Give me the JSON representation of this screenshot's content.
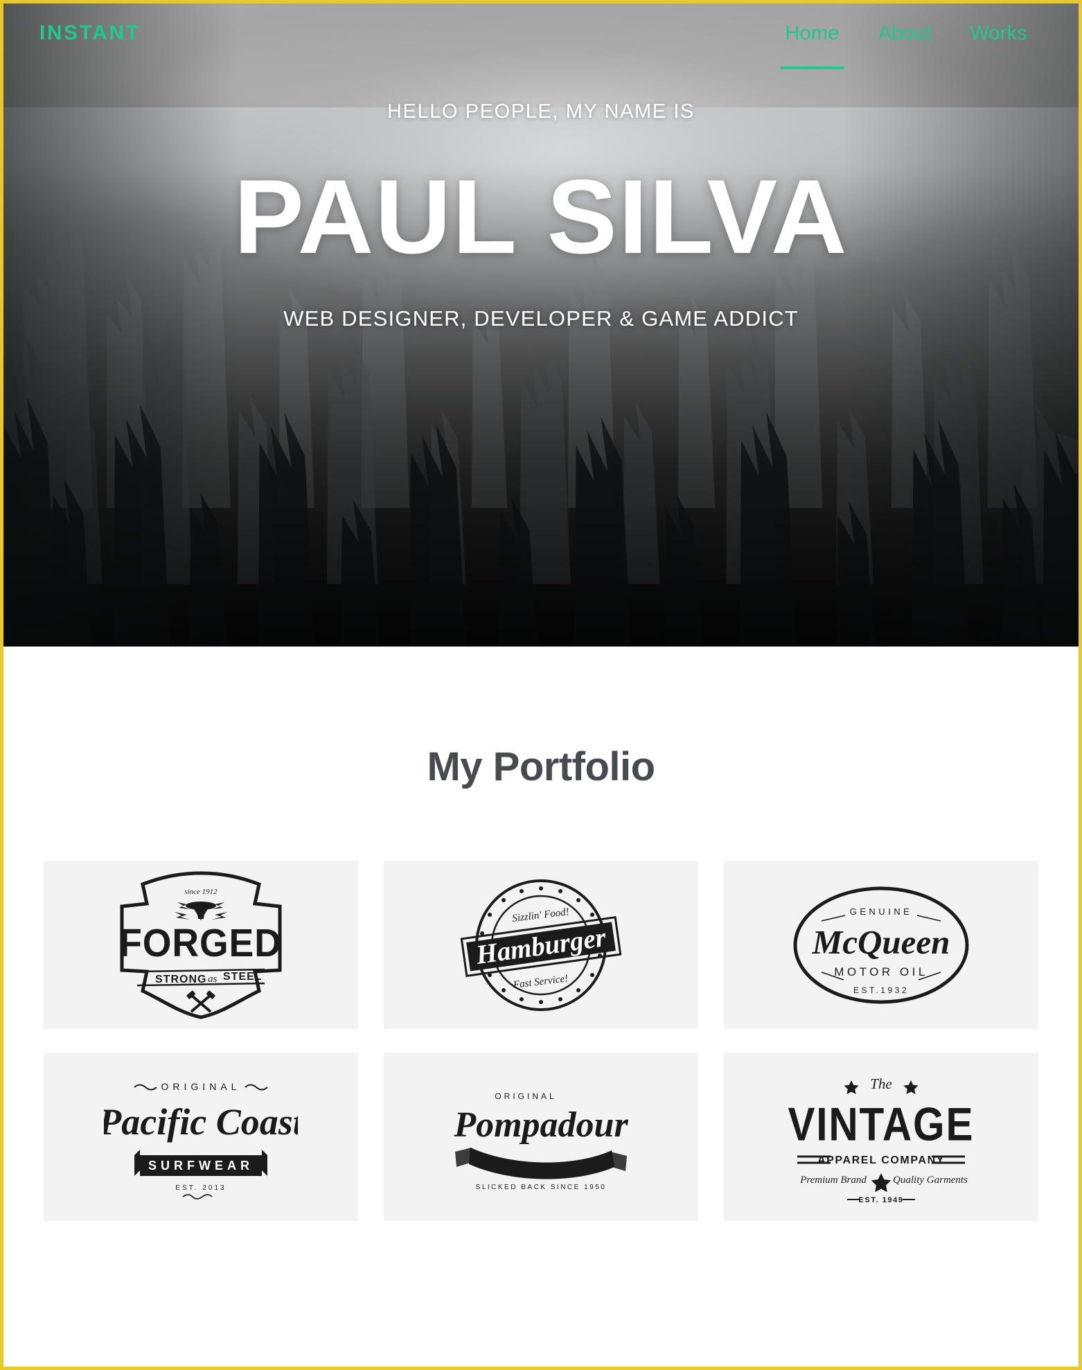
{
  "theme": {
    "accent": "#1ec98f",
    "page_border": "#e8c832",
    "heading_color": "#474b50",
    "card_bg": "#f3f3f3",
    "hero_text": "#ffffff"
  },
  "header": {
    "logo": "INSTANT",
    "nav": [
      {
        "label": "Home",
        "active": true
      },
      {
        "label": "About",
        "active": false
      },
      {
        "label": "Works",
        "active": false
      }
    ]
  },
  "hero": {
    "greeting": "HELLO PEOPLE, MY NAME IS",
    "name": "PAUL SILVA",
    "tagline": "WEB DESIGNER, DEVELOPER & GAME ADDICT",
    "background_image": "foggy-pine-forest-grayscale"
  },
  "portfolio": {
    "title": "My Portfolio",
    "items": [
      {
        "id": "forged",
        "name": "Forged badge logo",
        "lines": {
          "top": "since 1912",
          "main": "FORGED",
          "sub_a": "STRONG",
          "sub_b": "as",
          "sub_c": "STEEL"
        },
        "icons": [
          "anvil-icon",
          "lightning-bolt-icon",
          "crossed-hammers-icon"
        ]
      },
      {
        "id": "hamburger",
        "name": "Hamburger stamp logo",
        "lines": {
          "top": "Sizzlin' Food!",
          "main": "Hamburger",
          "bottom": "Fast Service!"
        },
        "icons": [
          "star-ring-icon"
        ]
      },
      {
        "id": "mcqueen",
        "name": "McQueen Motor Oil oval logo",
        "lines": {
          "top": "GENUINE",
          "main": "McQueen",
          "sub": "MOTOR OIL",
          "bottom": "EST.1932"
        },
        "icons": [
          "oval-frame-icon"
        ]
      },
      {
        "id": "pacific-coast",
        "name": "Pacific Coast Surfwear logo",
        "lines": {
          "top": "ORIGINAL",
          "main": "Pacific Coast",
          "banner": "SURFWEAR",
          "bottom": "EST. 2013"
        },
        "icons": [
          "flourish-icon",
          "ribbon-banner-icon"
        ]
      },
      {
        "id": "pompadour",
        "name": "Pompadour ribbon logo",
        "lines": {
          "top": "ORIGINAL",
          "main": "Pompadour",
          "banner": "SLICKED BACK SINCE 1950",
          "bottom": "SLICKED BACK SINCE 1950"
        },
        "icons": [
          "ribbon-banner-icon"
        ]
      },
      {
        "id": "vintage",
        "name": "The Vintage Apparel Company logo",
        "lines": {
          "top": "The",
          "main": "VINTAGE",
          "sub": "APPAREL COMPANY",
          "left": "Premium Brand",
          "right": "Quality Garments",
          "bottom": "EST. 1949"
        },
        "icons": [
          "star-icon",
          "double-rule-icon"
        ]
      }
    ]
  }
}
